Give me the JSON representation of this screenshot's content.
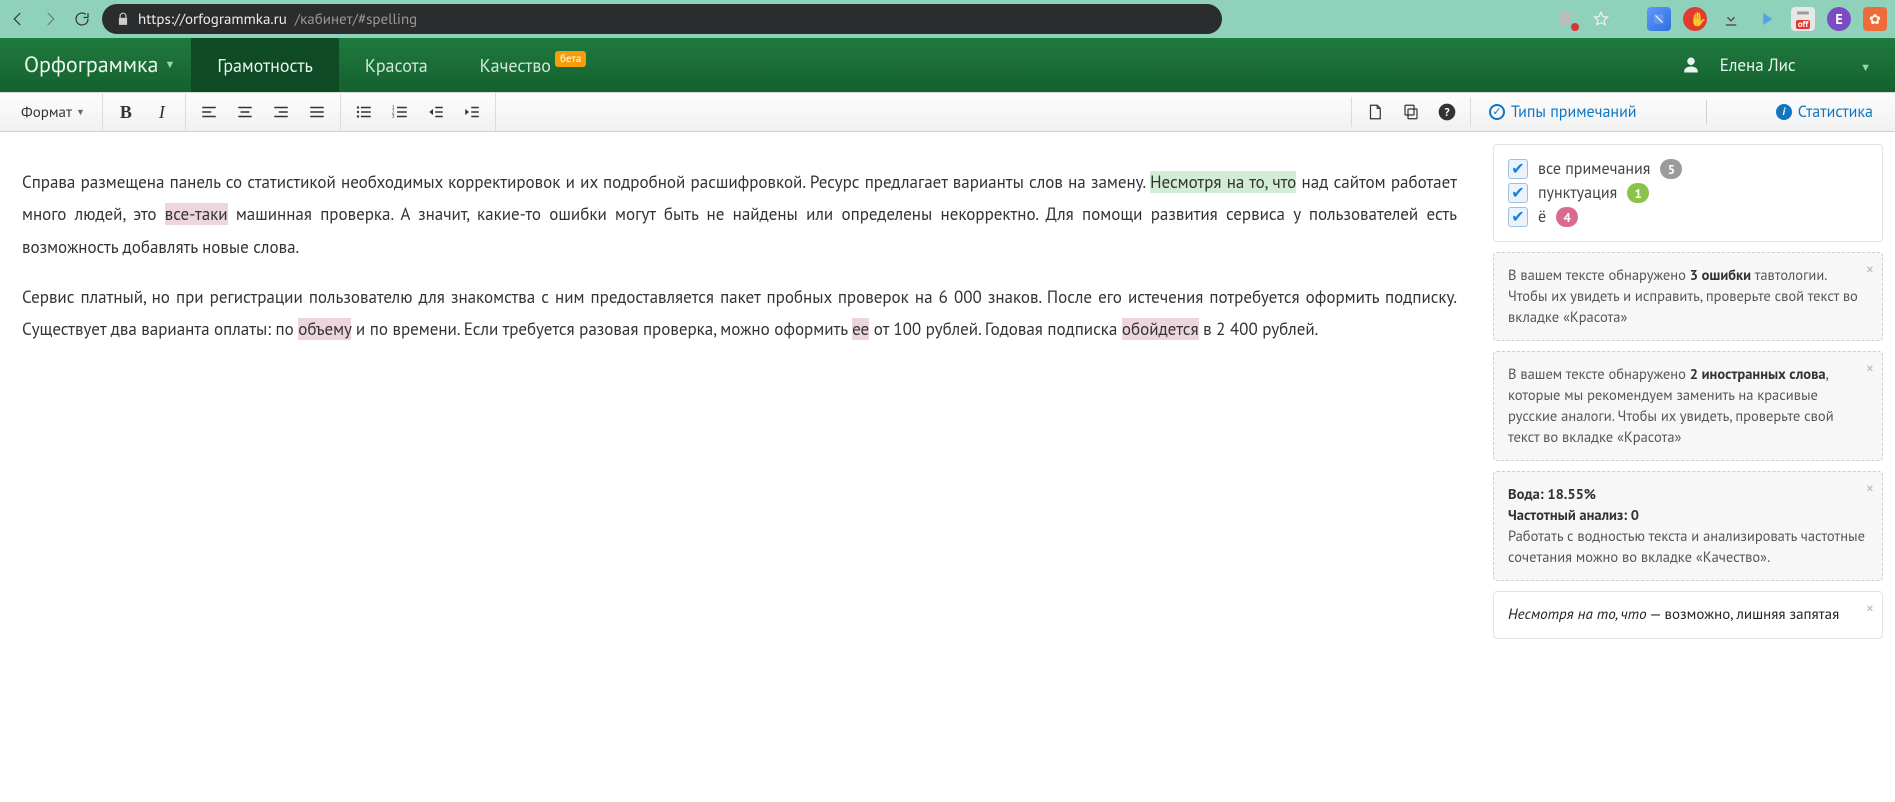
{
  "browser": {
    "url_secure": "https://orfogrammka.ru",
    "url_path": "/кабинет/#spelling",
    "off_label": "off",
    "avatar_letter": "Е"
  },
  "nav": {
    "brand": "Орфограммка",
    "tab_literacy": "Грамотность",
    "tab_beauty": "Красота",
    "tab_quality": "Качество",
    "beta": "бета",
    "username": "Елена Лис"
  },
  "toolbar": {
    "format": "Формат"
  },
  "sidebar_head": {
    "types": "Типы примечаний",
    "stats": "Статистика"
  },
  "filters": {
    "all_label": "все примечания",
    "all_count": "5",
    "punct_label": "пунктуация",
    "punct_count": "1",
    "yo_label": "ё",
    "yo_count": "4"
  },
  "cards": {
    "c1_pre": "В вашем тексте обнаружено ",
    "c1_bold": "3 ошибки",
    "c1_post": " тавтологии. Чтобы их увидеть и исправить, проверьте свой текст во вкладке «Красота»",
    "c2_pre": "В вашем тексте обнаружено ",
    "c2_bold": "2 иностранных слова",
    "c2_post": ", которые мы рекомендуем заменить на красивые русские аналоги. Чтобы их увидеть, проверьте свой текст во вкладке «Красота»",
    "c3_l1": "Вода: 18.55%",
    "c3_l2": "Частотный анализ: 0",
    "c3_body": "Работать с водностью текста и анализировать частотные сочетания можно во вкладке «Качество».",
    "c4_em": "Несмотря на то, что",
    "c4_rest": " — возможно, лишняя запятая"
  },
  "editor": {
    "p1_a": "Справа размещена панель со статистикой необходимых корректировок и их подробной расшифровкой. Ресурс предлагает варианты слов на замену. ",
    "p1_hl1": "Несмотря на то, что",
    "p1_b": " над сайтом работает много людей, это ",
    "p1_hl2": "все-таки",
    "p1_c": " машинная проверка. А значит, какие-то ошибки могут быть не найдены или определены некорректно. Для помощи развития сервиса у пользователей есть возможность добавлять новые слова.",
    "p2_a": "Сервис платный, но при регистрации пользователю для знакомства с ним предоставляется пакет пробных проверок на 6 000 знаков. После его истечения потребуется оформить подписку. Существует два варианта оплаты: по ",
    "p2_hl1": "объему",
    "p2_b": " и по времени. Если требуется разовая проверка, можно оформить ",
    "p2_hl2": "ее",
    "p2_c": " от 100 рублей. Годовая подписка ",
    "p2_hl3": "обойдется",
    "p2_d": " в 2 400 рублей."
  }
}
